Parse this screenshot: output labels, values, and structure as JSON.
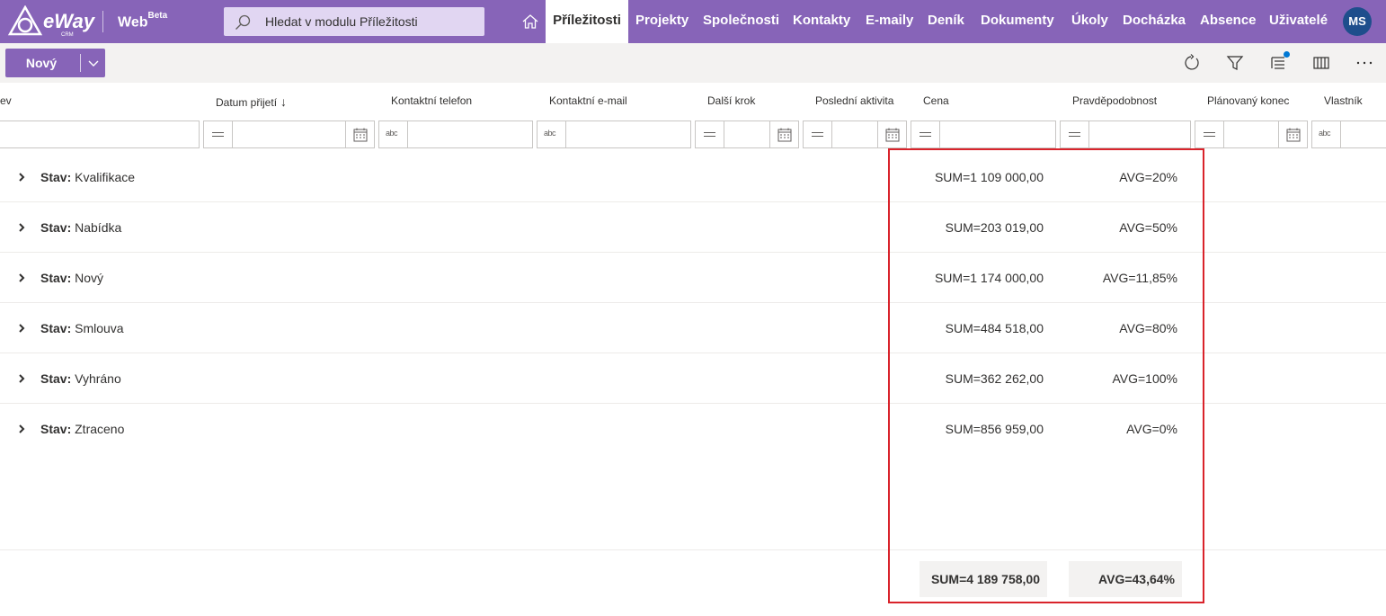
{
  "app": {
    "logo_text": "eWay",
    "logo_sub": "CRM",
    "web_label": "Web",
    "web_badge": "Beta"
  },
  "search": {
    "placeholder": "Hledat v modulu Příležitosti"
  },
  "nav": {
    "active": "Příležitosti",
    "items": [
      "Projekty",
      "Společnosti",
      "Kontakty",
      "E-maily",
      "Deník",
      "Dokumenty",
      "Úkoly",
      "Docházka",
      "Absence",
      "Uživatelé"
    ]
  },
  "user": {
    "initials": "MS"
  },
  "toolbar": {
    "new_label": "Nový"
  },
  "columns": [
    "ev",
    "Datum přijetí",
    "Kontaktní telefon",
    "Kontaktní e-mail",
    "Další krok",
    "Poslední aktivita",
    "Cena",
    "Pravděpodobnost",
    "Plánovaný konec",
    "Vlastník"
  ],
  "sort_indicator": "↓",
  "filter_text_icon": "abc",
  "group_label": "Stav:",
  "groups": [
    {
      "name": "Kvalifikace",
      "sum": "SUM=1 109 000,00",
      "avg": "AVG=20%"
    },
    {
      "name": "Nabídka",
      "sum": "SUM=203 019,00",
      "avg": "AVG=50%"
    },
    {
      "name": "Nový",
      "sum": "SUM=1 174 000,00",
      "avg": "AVG=11,85%"
    },
    {
      "name": "Smlouva",
      "sum": "SUM=484 518,00",
      "avg": "AVG=80%"
    },
    {
      "name": "Vyhráno",
      "sum": "SUM=362 262,00",
      "avg": "AVG=100%"
    },
    {
      "name": "Ztraceno",
      "sum": "SUM=856 959,00",
      "avg": "AVG=0%"
    }
  ],
  "totals": {
    "sum": "SUM=4 189 758,00",
    "avg": "AVG=43,64%"
  },
  "colors": {
    "brand": "#8764b8",
    "highlight": "#d9232b",
    "avatar": "#1e4e8c"
  }
}
